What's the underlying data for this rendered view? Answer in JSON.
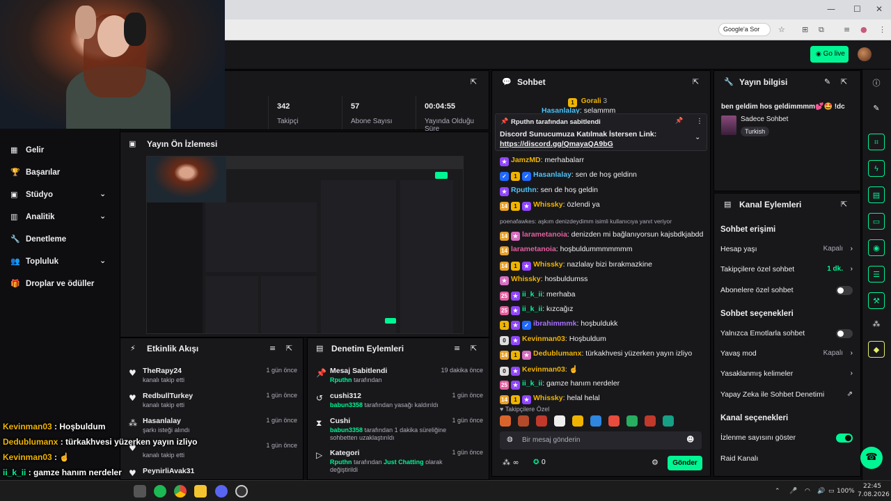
{
  "browser": {
    "google_pill": "Google'a Sor",
    "win_min": "—",
    "win_max": "☐",
    "win_close": "✕"
  },
  "topbar": {
    "go_live": "Go live"
  },
  "sidebar": {
    "items": [
      {
        "label": "Gelir",
        "icon": "chart-icon"
      },
      {
        "label": "Başarılar",
        "icon": "trophy-icon"
      },
      {
        "label": "Stüdyo",
        "icon": "studio-icon",
        "chevron": true
      },
      {
        "label": "Analitik",
        "icon": "analytics-icon",
        "chevron": true
      },
      {
        "label": "Denetleme",
        "icon": "wrench-icon"
      },
      {
        "label": "Topluluk",
        "icon": "community-icon",
        "chevron": true
      },
      {
        "label": "Droplar ve ödüller",
        "icon": "gift-icon"
      }
    ]
  },
  "overlay_chat": [
    {
      "name": "Kevinman03",
      "sep": ":",
      "text": "Hoşbuldum",
      "color": "#f0b400"
    },
    {
      "name": "Dedublumanx",
      "sep": ":",
      "text": "türkakhvesi yüzerken yayın izliyo",
      "color": "#f0b400"
    },
    {
      "name": "Kevinman03",
      "sep": ":",
      "text": "☝",
      "color": "#f0b400"
    },
    {
      "name": "ii_k_ii",
      "sep": ":",
      "text": "gamze hanım nerdeler",
      "color": "#00f593"
    },
    {
      "name": "Whissky",
      "sep": ":",
      "text": "helal helal",
      "color": "#f0b400"
    }
  ],
  "stats": [
    {
      "value": "342",
      "label": "Takipçi"
    },
    {
      "value": "57",
      "label": "Abone Sayısı"
    },
    {
      "value": "00:04:55",
      "label": "Yayında Olduğu Süre"
    }
  ],
  "preview": {
    "title": "Yayın Ön İzlemesi"
  },
  "activity": {
    "title": "Etkinlik Akışı",
    "items": [
      {
        "name": "TheRapy24",
        "sub": "kanalı takip etti",
        "time": "1 gün önce",
        "icon": "heart-icon"
      },
      {
        "name": "RedbullTurkey",
        "sub": "kanalı takip etti",
        "time": "1 gün önce",
        "icon": "heart-icon"
      },
      {
        "name": "Hasanlalay",
        "sub": "şarkı isteği alındı",
        "time": "1 gün önce",
        "icon": "points-icon"
      },
      {
        "name": "",
        "sub": "kanalı takip etti",
        "time": "1 gün önce",
        "icon": "heart-icon"
      },
      {
        "name": "PeynirliAvak31",
        "sub": "",
        "time": "",
        "icon": "heart-icon"
      }
    ]
  },
  "moderation": {
    "title": "Denetim Eylemleri",
    "items": [
      {
        "name": "Mesaj Sabitlendi",
        "user": "Rputhn",
        "sub": "tarafından",
        "time": "19 dakika önce",
        "icon": "pin-icon"
      },
      {
        "name": "cushi312",
        "user": "babun3358",
        "sub": "tarafından yasağı kaldırıldı",
        "time": "1 gün önce",
        "icon": "undo-icon"
      },
      {
        "name": "Cushi",
        "user": "babun3358",
        "sub": "tarafından 1 dakika süreliğine sohbetten uzaklaştırıldı",
        "time": "1 gün önce",
        "icon": "hourglass-icon"
      },
      {
        "name": "Kategori",
        "user": "Rputhn",
        "sub": "tarafından",
        "extra": "Just Chatting",
        "tail": "olarak değiştirildi",
        "time": "1 gün önce",
        "icon": "category-icon"
      }
    ]
  },
  "chat": {
    "title": "Sohbet",
    "top_name": "Gorali",
    "top_count": "3",
    "pinned_by": "Rputhn tarafından sabitlendi",
    "pinned_text": "Discord Sunucumuza Katılmak İstersen Link:",
    "pinned_link": "https://discord.gg/QmayaQA9bG",
    "partial_name": "Hasanlalay",
    "partial_text": "selammm",
    "messages": [
      {
        "badges": [
          "b-prime"
        ],
        "name": "JamzMD",
        "color": "#f0b400",
        "text": "merhabalarr"
      },
      {
        "badges": [
          "b-blue",
          "b-yellow",
          "b-blue"
        ],
        "name": "Hasanlalay",
        "color": "#4fc3f7",
        "text": "sen de hoş geldinn"
      },
      {
        "badges": [
          "b-prime"
        ],
        "name": "Rputhn",
        "color": "#4fc3f7",
        "text": "sen de hoş geldin"
      },
      {
        "badges": [
          "b-sub",
          "b-yellow",
          "b-prime"
        ],
        "name": "Whissky",
        "color": "#f0b400",
        "text": "özlendi ya"
      },
      {
        "reply": "poenafawkes: aşkım denizdeydimm isimli kullanıcıya yanıt veriyor"
      },
      {
        "badges": [
          "b-sub",
          "b-vip"
        ],
        "name": "larametanoia",
        "color": "#e55fa0",
        "text": "denizden mi bağlanıyorsun kajsbdkjabdd"
      },
      {
        "badges": [
          "b-sub"
        ],
        "name": "larametanoia",
        "color": "#e55fa0",
        "text": "hoşbuldummmmmmm"
      },
      {
        "badges": [
          "b-sub",
          "b-yellow",
          "b-prime"
        ],
        "name": "Whissky",
        "color": "#f0b400",
        "text": "nazlalay bizi bırakmazkine"
      },
      {
        "badges": [
          "b-vip"
        ],
        "name": "Whissky",
        "color": "#f0b400",
        "text": "hosbuldumss"
      },
      {
        "badges": [
          "b-pink",
          "b-prime"
        ],
        "name": "ii_k_ii",
        "color": "#00f593",
        "text": "merhaba"
      },
      {
        "badges": [
          "b-pink",
          "b-prime"
        ],
        "name": "ii_k_ii",
        "color": "#00f593",
        "text": "kızcağız"
      },
      {
        "badges": [
          "b-yellow",
          "b-prime",
          "b-blue"
        ],
        "name": "ibrahimmmk",
        "color": "#a970ff",
        "text": "hoşbuldukk"
      },
      {
        "badges": [
          "b-white",
          "b-prime"
        ],
        "name": "Kevinman03",
        "color": "#f0b400",
        "text": "Hoşbuldum"
      },
      {
        "badges": [
          "b-sub",
          "b-yellow",
          "b-vip"
        ],
        "name": "Dedublumanx",
        "color": "#f0b400",
        "text": "türkakhvesi yüzerken yayın izliyo"
      },
      {
        "badges": [
          "b-white",
          "b-prime"
        ],
        "name": "Kevinman03",
        "color": "#f0b400",
        "text": "☝"
      },
      {
        "badges": [
          "b-pink",
          "b-prime"
        ],
        "name": "ii_k_ii",
        "color": "#00f593",
        "text": "gamze hanım nerdeler"
      },
      {
        "badges": [
          "b-sub",
          "b-yellow",
          "b-prime"
        ],
        "name": "Whissky",
        "color": "#f0b400",
        "text": "helal helal"
      }
    ],
    "follower_only": "Takipçilere Özel",
    "input_placeholder": "Bir mesaj gönderin",
    "points": "∞",
    "bits": "0",
    "send": "Gönder"
  },
  "stream_info": {
    "title": "Yayın bilgisi",
    "stream_title": "ben geldim hos geldimmmm💕🤩 !dc",
    "category": "Sadece Sohbet",
    "tag": "Turkish"
  },
  "channel_actions": {
    "title": "Kanal Eylemleri",
    "chat_access": "Sohbet erişimi",
    "account_age": {
      "label": "Hesap yaşı",
      "value": "Kapalı"
    },
    "followers_only": {
      "label": "Takipçilere özel sohbet",
      "value": "1 dk."
    },
    "subs_only": {
      "label": "Abonelere özel sohbet",
      "on": false
    },
    "chat_options": "Sohbet seçenekleri",
    "emote_only": {
      "label": "Yalnızca Emotlarla sohbet",
      "on": false
    },
    "slow_mode": {
      "label": "Yavaş mod",
      "value": "Kapalı"
    },
    "banned_words": {
      "label": "Yasaklanmış kelimeler"
    },
    "ai_mod": {
      "label": "Yapay Zeka ile Sohbet Denetimi"
    },
    "channel_options": "Kanal seçenekleri",
    "viewer_count": {
      "label": "İzlenme sayısını göster",
      "on": true
    },
    "raid": {
      "label": "Raid Kanalı"
    }
  },
  "taskbar": {
    "time": "22:45",
    "date": "7.08.2026",
    "battery": "100%"
  }
}
